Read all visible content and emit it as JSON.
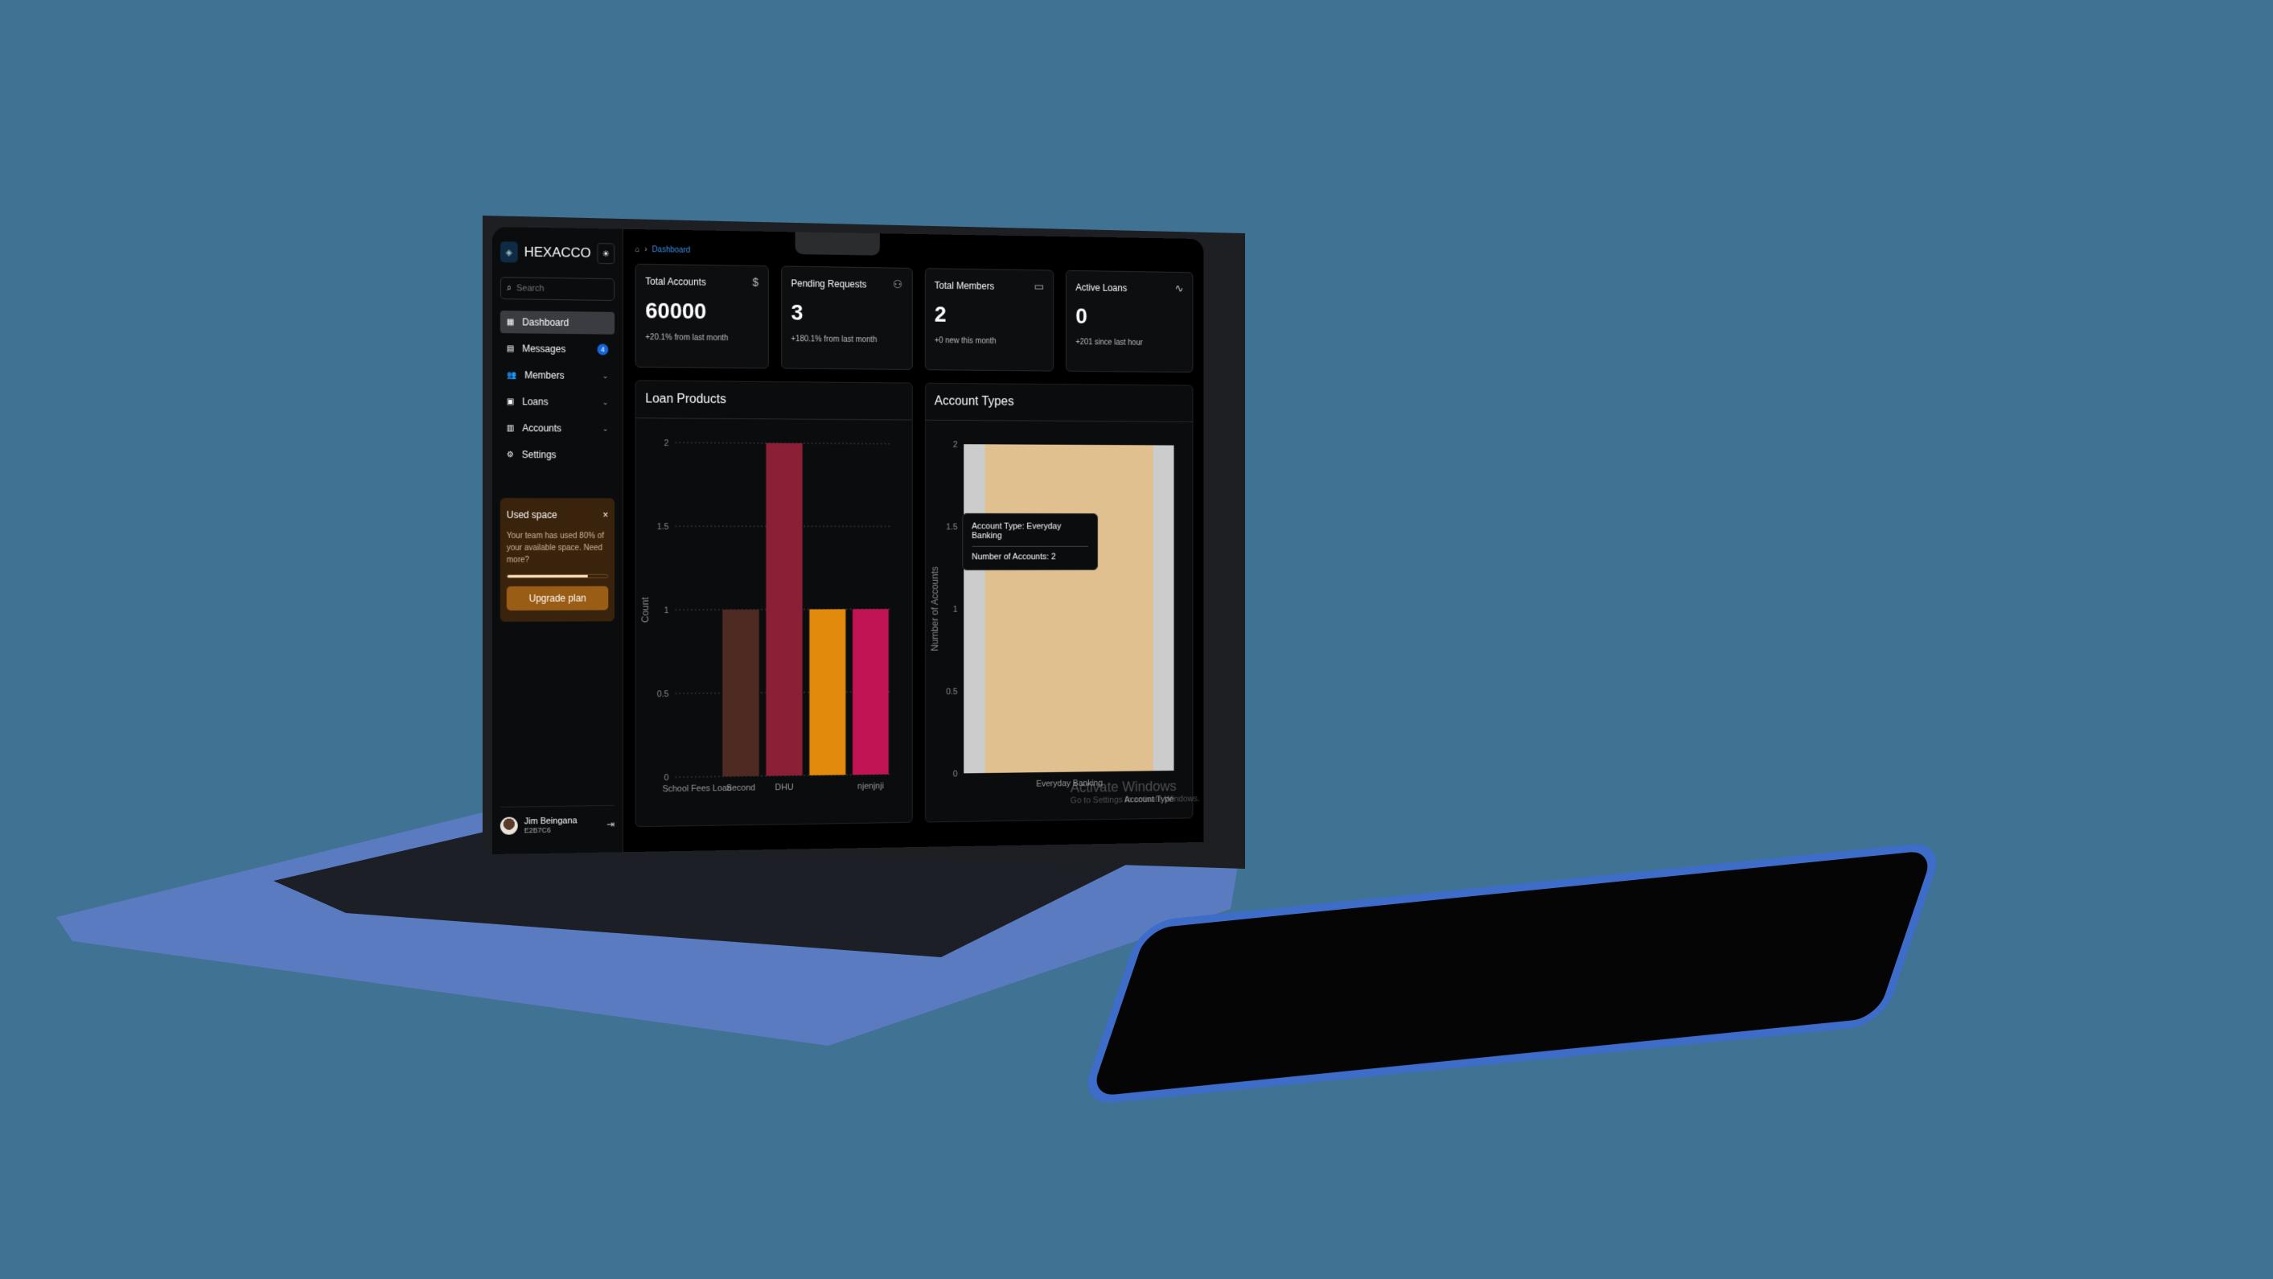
{
  "sidebar": {
    "brand": "HEXACCO",
    "search_placeholder": "Search",
    "items": [
      {
        "label": "Dashboard",
        "icon": "dashboard-icon",
        "active": true
      },
      {
        "label": "Messages",
        "icon": "messages-icon",
        "badge": "4"
      },
      {
        "label": "Members",
        "icon": "members-icon",
        "chevron": true
      },
      {
        "label": "Loans",
        "icon": "loans-icon",
        "chevron": true
      },
      {
        "label": "Accounts",
        "icon": "accounts-icon",
        "chevron": true
      },
      {
        "label": "Settings",
        "icon": "gear-icon"
      }
    ],
    "used_space": {
      "title": "Used space",
      "text": "Your team has used 80% of your available space. Need more?",
      "percent": 80,
      "button": "Upgrade plan"
    },
    "user": {
      "name": "Jim Beingana",
      "id": "E2B7C6"
    }
  },
  "breadcrumb": {
    "current": "Dashboard"
  },
  "cards": [
    {
      "title": "Total Accounts",
      "value": "60000",
      "sub": "+20.1% from last month",
      "icon": "dollar-icon"
    },
    {
      "title": "Pending Requests",
      "value": "3",
      "sub": "+180.1% from last month",
      "icon": "users-icon"
    },
    {
      "title": "Total Members",
      "value": "2",
      "sub": "+0 new this month",
      "icon": "card-icon"
    },
    {
      "title": "Active Loans",
      "value": "0",
      "sub": "+201 since last hour",
      "icon": "activity-icon"
    }
  ],
  "watermark": {
    "title": "Activate Windows",
    "sub": "Go to Settings to activate Windows."
  },
  "colors": {
    "background": "#3f7293",
    "device": "#4a72c4",
    "accent": "#1565d8"
  },
  "chart_data": [
    {
      "type": "bar",
      "title": "Loan Products",
      "ylabel": "Count",
      "xlabel": "",
      "ylim": [
        0,
        2
      ],
      "yticks": [
        0,
        0.5,
        1,
        1.5,
        2
      ],
      "categories": [
        "School Fees Loan",
        "Second",
        "DHU",
        "",
        "njenjnji"
      ],
      "values": [
        0,
        1,
        2,
        1,
        1
      ],
      "colors": [
        "#888888",
        "#4e2a22",
        "#8b1f35",
        "#e28a0b",
        "#c01455"
      ],
      "grid": true
    },
    {
      "type": "bar",
      "title": "Account Types",
      "ylabel": "Number of Accounts",
      "xlabel": "Account Type",
      "ylim": [
        0,
        2
      ],
      "yticks": [
        0,
        0.5,
        1,
        1.5,
        2
      ],
      "categories": [
        "Everyday Banking"
      ],
      "values": [
        2
      ],
      "colors": [
        "#dfc08e"
      ],
      "grid": false,
      "tooltip": {
        "label1": "Account Type:",
        "value1": "Everyday Banking",
        "label2": "Number of Accounts:",
        "value2": "2"
      }
    }
  ]
}
